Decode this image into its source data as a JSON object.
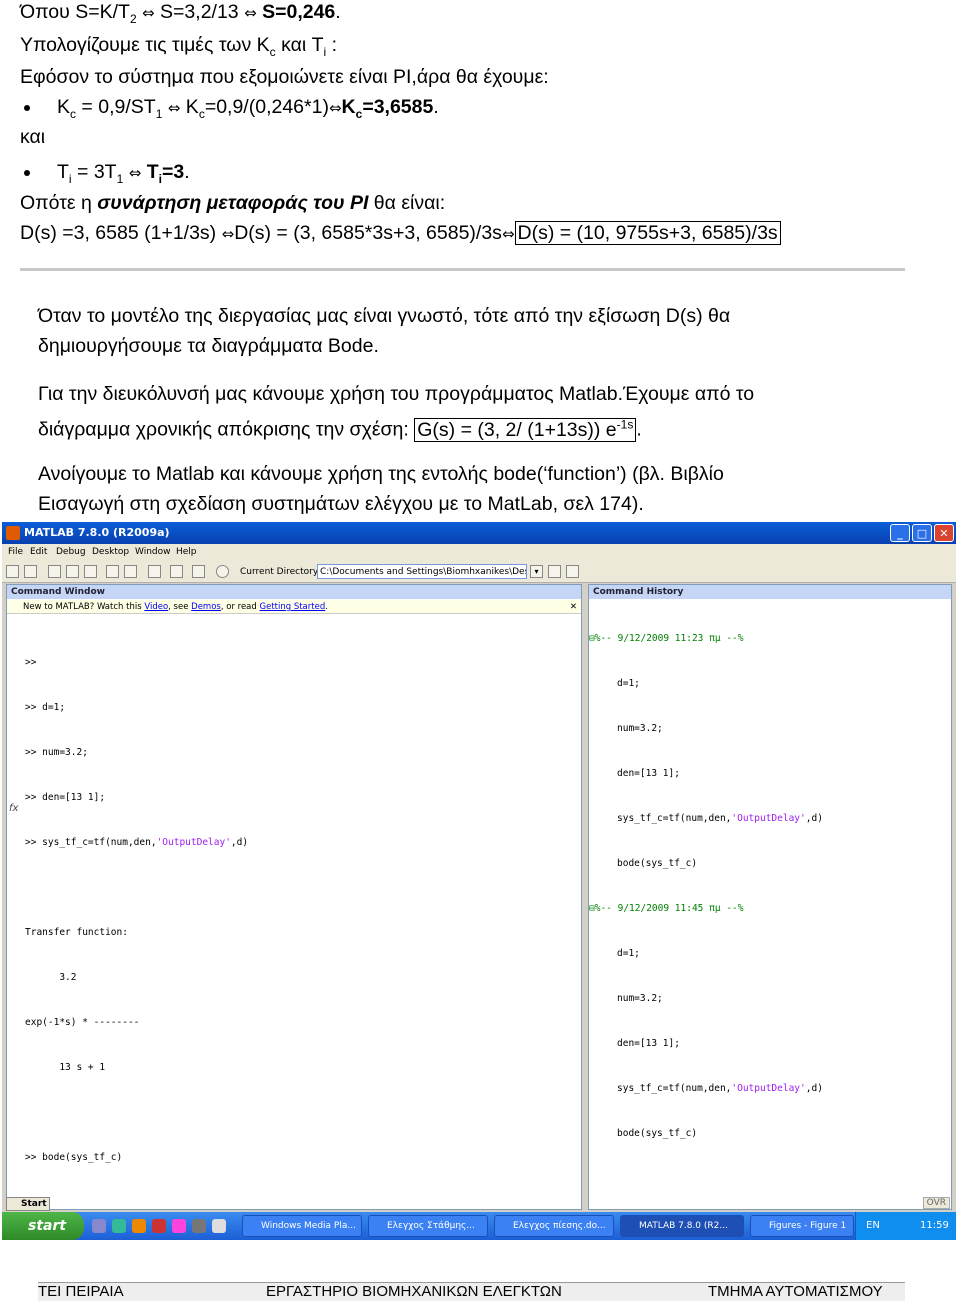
{
  "top": {
    "line1_a": "Όπου S=K/T",
    "line1_sub": "2",
    "line1_b": " S=3,2/13 ",
    "line1_c": "S=0,246",
    "line2": "Υπολογίζουμε τις τιμές των K",
    "line2_sub1": "c",
    "line2_mid": " και T",
    "line2_sub2": "i",
    "line2_end": " :",
    "line3": "Εφόσον το σύστημα που εξομοιώνετε είναι PI,άρα θα έχουμε:",
    "bullet1_a": "K",
    "bullet1_sub": "c",
    "bullet1_b": " = 0,9/ST",
    "bullet1_sub2": "1",
    "bullet1_c": " K",
    "bullet1_sub3": "c",
    "bullet1_d": "=0,9/(0,246*1)",
    "bullet1_e": "K",
    "bullet1_sub4": "c",
    "bullet1_f": "=3,6585",
    "kai": "και",
    "bullet2_a": "T",
    "bullet2_sub": "i",
    "bullet2_b": " = 3T",
    "bullet2_sub2": "1",
    "bullet2_c": "T",
    "bullet2_sub3": "i",
    "bullet2_d": "=3",
    "pi_a": "Οπότε η ",
    "pi_b": "συνάρτηση μεταφοράς του PI",
    "pi_c": " θα είναι:",
    "ds_a": "D(s) =3, 6585 (1+1/3s) ",
    "ds_b": "D(s) = (3, 6585*3s+3, 6585)/3s",
    "ds_c": "D(s) = (10, 9755s+3, 6585)/3s",
    "arrow": "⇔"
  },
  "body": {
    "p1_l1": "Όταν το μοντέλο της διεργασίας μας είναι γνωστό, τότε από την εξίσωση D(s) θα",
    "p1_l2": "δημιουργήσουμε τα διαγράμματα Bode.",
    "p2_l1": "Για την διευκόλυνσή μας κάνουμε χρήση του προγράμματος Matlab.Έχουμε από το",
    "p2_l2_a": "διάγραμμα χρονικής απόκρισης την σχέση: ",
    "p2_l2_box": "G(s) = (3, 2/ (1+13s)) e",
    "p2_l2_sup": "-1s",
    "p2_l2_end": ".",
    "p3_l1": "Ανοίγουμε το Matlab και κάνουμε χρήση της εντολής bode(‘function’) (βλ. Βιβλίο",
    "p3_l2": "Εισαγωγή στη σχεδίαση συστημάτων ελέγχου με το MatLab, σελ 174)."
  },
  "matlab": {
    "title": "MATLAB 7.8.0 (R2009a)",
    "menus": [
      "File",
      "Edit",
      "Debug",
      "Desktop",
      "Window",
      "Help"
    ],
    "current_dir_label": "Current Directory:",
    "current_dir": "C:\\Documents and Settings\\Biomhxanikes\\Desktop",
    "command_window_title": "Command Window",
    "new_to": "New to MATLAB? Watch this ",
    "new_to_video": "Video",
    "new_to_sep": ", see ",
    "new_to_demos": "Demos",
    "new_to_or": ", or read ",
    "new_to_gs": "Getting Started",
    "new_to_end": ".",
    "cw_lines": [
      ">>",
      ">> d=1;",
      ">> num=3.2;",
      ">> den=[13 1];",
      ">> sys_tf_c=tf(num,den,",
      "",
      "Transfer function:",
      "      3.2",
      "exp(-1*s) * --------",
      "      13 s + 1",
      "",
      ">> bode(sys_tf_c)",
      ">>"
    ],
    "cw_str": "'OutputDelay'",
    "cw_tail": ",d)",
    "fx": "fx",
    "history_title": "Command History",
    "h_sep1": "%-- 9/12/2009 11:23 πμ --%",
    "h_sep2": "%-- 9/12/2009 11:45 πμ --%",
    "h_group": [
      "d=1;",
      "num=3.2;",
      "den=[13 1];",
      "sys_tf_c=tf(num,den,",
      "bode(sys_tf_c)"
    ],
    "h_str": "'OutputDelay'",
    "h_tail": ",d)",
    "start_small": "Start",
    "ovr": "OVR",
    "taskbar_start": "start",
    "tasks": [
      "Windows Media Pla...",
      "Ελεγχος Στάθμης...",
      "Ελεγχος πίεσης.do...",
      "MATLAB 7.8.0 (R2...",
      "Figures - Figure 1"
    ],
    "lang": "EN",
    "clock": "11:59"
  },
  "footer": {
    "left": "ΤΕΙ ΠΕΙΡΑΙΑ",
    "center": "ΕΡΓΑΣΤΗΡΙΟ ΒΙΟΜΗΧΑΝΙΚΩΝ ΕΛΕΓΚΤΩΝ",
    "right": "ΤΜΗΜΑ ΑΥΤΟΜΑΤΙΣΜΟΥ"
  }
}
